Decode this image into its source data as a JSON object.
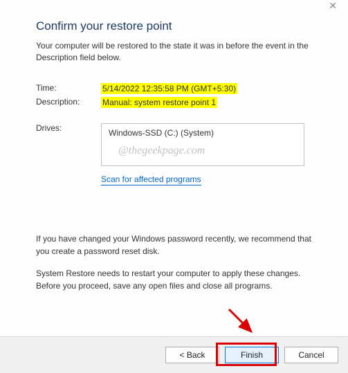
{
  "title": "Confirm your restore point",
  "intro": "Your computer will be restored to the state it was in before the event in the Description field below.",
  "labels": {
    "time": "Time:",
    "description": "Description:",
    "drives": "Drives:"
  },
  "values": {
    "time": "5/14/2022 12:35:58 PM (GMT+5:30)",
    "description": "Manual: system restore point 1",
    "drive": "Windows-SSD (C:) (System)"
  },
  "watermark": "@thegeekpage.com",
  "scan_link": "Scan for affected programs",
  "note1": "If you have changed your Windows password recently, we recommend that you create a password reset disk.",
  "note2": "System Restore needs to restart your computer to apply these changes. Before you proceed, save any open files and close all programs.",
  "buttons": {
    "back": "< Back",
    "finish": "Finish",
    "cancel": "Cancel"
  }
}
